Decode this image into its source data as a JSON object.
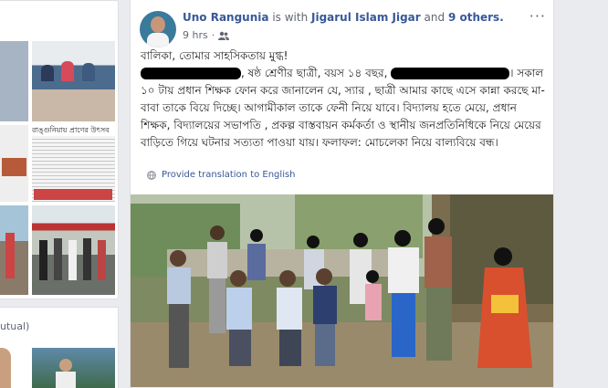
{
  "left_panel": {
    "caption_fragment": "রাঙ্গুনিয়ায় প্রাণের উৎসব",
    "mutual_label": "utual)"
  },
  "post": {
    "author": "Uno Rangunia",
    "is_with": "is with",
    "tagged": "Jigarul Islam Jigar",
    "and_text": "and",
    "others": "9 others.",
    "time": "9 hrs",
    "privacy_sep": "·",
    "menu": "···",
    "line1": "বালিকা, তোমার সাহসিকতায় মুগ্ধ!",
    "para_a": ", ষষ্ঠ শ্রেণীর ছাত্রী, বয়স ১৪ বছর,",
    "para_b": "। সকাল ১০ টায় প্রধান শিক্ষক ফোন করে জানালেন যে, স্যার , ছাত্রী আমার কাছে এসে কান্না করছে মা- বাবা তাকে বিয়ে দিচ্ছে। আগামীকাল তাকে ফেনী নিয়ে যাবে। বিদ্যালয় হতে মেয়ে, প্রধান শিক্ষক, বিদ্যালয়ের সভাপতি , প্রকল্প বাস্তবায়ন কর্মকর্তা ও স্থানীয় জনপ্রতিনিধিকে নিয়ে মেয়ের বাড়িতে গিয়ে ঘটনার সত্যতা পাওয়া যায়। ফলাফল: মোচলেকা নিয়ে বাল্যবিয়ে বন্ধ।",
    "translate": "Provide translation to English"
  },
  "colors": {
    "link": "#385898",
    "text": "#1c1e21",
    "muted": "#616770",
    "bg": "#e9ebee"
  }
}
